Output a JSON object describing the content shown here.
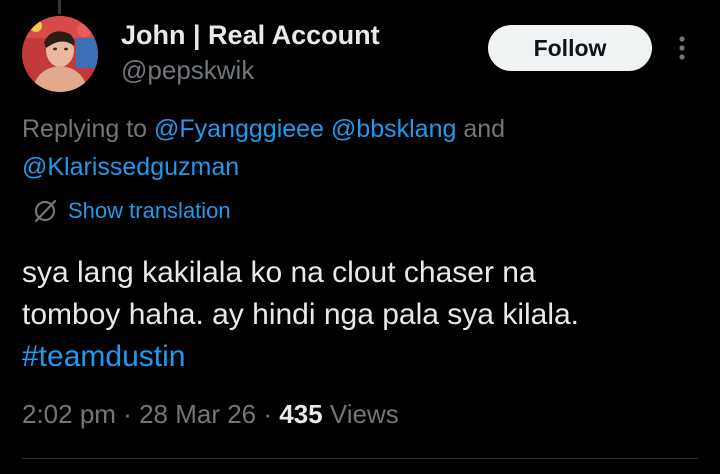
{
  "author": {
    "display_name": "John | Real Account",
    "handle": "@pepskwik"
  },
  "follow_button": {
    "label": "Follow"
  },
  "more_menu": {
    "icon": "more-vertical-icon"
  },
  "reply_context": {
    "prefix": "Replying to ",
    "mention_1": "@Fyangggieee",
    "mention_2": "@bbsklang",
    "connector": " and",
    "mention_3": "@Klarissedguzman"
  },
  "translation": {
    "icon": "globe-slash-icon",
    "label": "Show translation"
  },
  "tweet": {
    "line_1": "sya lang kakilala ko na clout chaser na",
    "line_2": "tomboy haha. ay hindi nga pala sya kilala.",
    "hashtag": "#teamdustin"
  },
  "meta": {
    "time": "2:02 pm",
    "separator": " · ",
    "date": "28 Mar 26",
    "views_count": "435",
    "views_label": " Views"
  },
  "colors": {
    "background": "#000000",
    "text_primary": "#e7e9ea",
    "text_secondary": "#71767b",
    "link_blue": "#1d9bf0",
    "follow_bg": "#eff3f4"
  }
}
